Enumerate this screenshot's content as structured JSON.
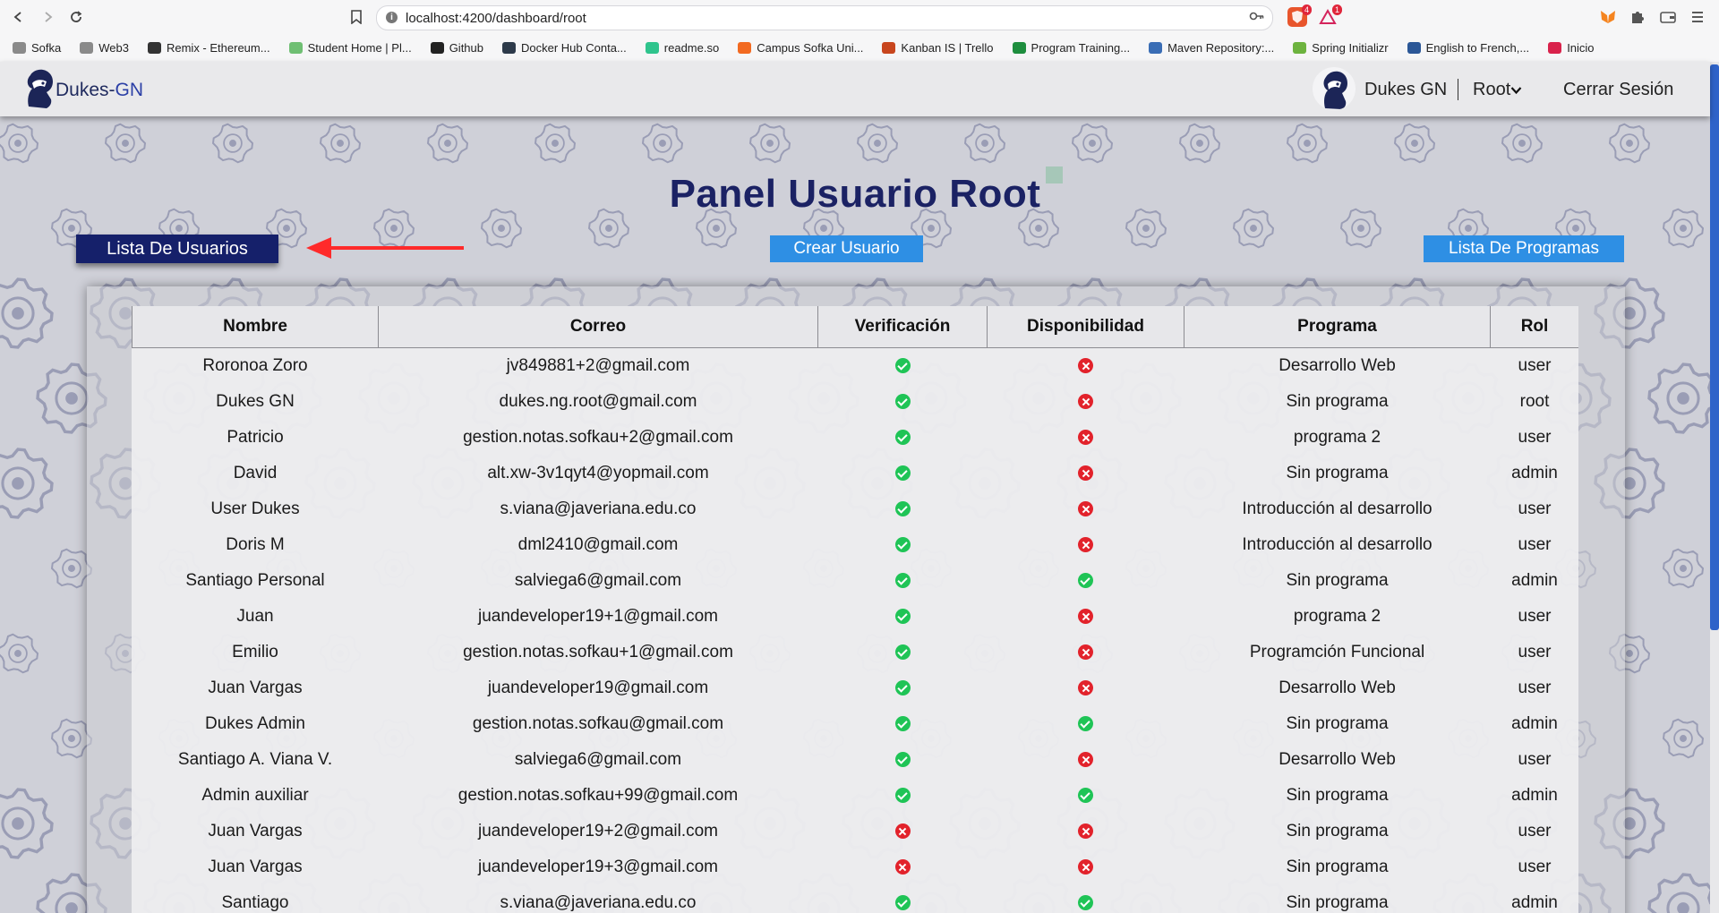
{
  "browser": {
    "url": "localhost:4200/dashboard/root",
    "extension_badges": [
      "4",
      "1"
    ],
    "bookmarks": [
      {
        "label": "Sofka",
        "color": "#8a8a8a"
      },
      {
        "label": "Web3",
        "color": "#8a8a8a"
      },
      {
        "label": "Remix - Ethereum...",
        "color": "#333333"
      },
      {
        "label": "Student Home | Pl...",
        "color": "#6fbf73"
      },
      {
        "label": "Github",
        "color": "#222222"
      },
      {
        "label": "Docker Hub Conta...",
        "color": "#2d3a4a"
      },
      {
        "label": "readme.so",
        "color": "#2fc48d"
      },
      {
        "label": "Campus Sofka Uni...",
        "color": "#f26a21"
      },
      {
        "label": "Kanban IS | Trello",
        "color": "#c8461e"
      },
      {
        "label": "Program Training...",
        "color": "#1e8e3e"
      },
      {
        "label": "Maven Repository:...",
        "color": "#3a6db5"
      },
      {
        "label": "Spring Initializr",
        "color": "#6db33f"
      },
      {
        "label": "English to French,...",
        "color": "#2b5797"
      },
      {
        "label": "Inicio",
        "color": "#d9224b"
      }
    ]
  },
  "header": {
    "brand_part1": "Dukes-",
    "brand_part2": "GN",
    "user_name": "Dukes GN",
    "role_menu": "Root",
    "logout": "Cerrar Sesión"
  },
  "page": {
    "title": "Panel Usuario Root",
    "btn_lista_usuarios": "Lista De Usuarios",
    "btn_crear_usuario": "Crear Usuario",
    "btn_lista_programas": "Lista De Programas"
  },
  "table": {
    "columns": [
      "Nombre",
      "Correo",
      "Verificación",
      "Disponibilidad",
      "Programa",
      "Rol"
    ],
    "rows": [
      {
        "nombre": "Roronoa Zoro",
        "correo": "jv849881+2@gmail.com",
        "verificado": true,
        "disponible": false,
        "programa": "Desarrollo Web",
        "rol": "user"
      },
      {
        "nombre": "Dukes GN",
        "correo": "dukes.ng.root@gmail.com",
        "verificado": true,
        "disponible": false,
        "programa": "Sin programa",
        "rol": "root"
      },
      {
        "nombre": "Patricio",
        "correo": "gestion.notas.sofkau+2@gmail.com",
        "verificado": true,
        "disponible": false,
        "programa": "programa 2",
        "rol": "user"
      },
      {
        "nombre": "David",
        "correo": "alt.xw-3v1qyt4@yopmail.com",
        "verificado": true,
        "disponible": false,
        "programa": "Sin programa",
        "rol": "admin"
      },
      {
        "nombre": "User Dukes",
        "correo": "s.viana@javeriana.edu.co",
        "verificado": true,
        "disponible": false,
        "programa": "Introducción al desarrollo",
        "rol": "user"
      },
      {
        "nombre": "Doris M",
        "correo": "dml2410@gmail.com",
        "verificado": true,
        "disponible": false,
        "programa": "Introducción al desarrollo",
        "rol": "user"
      },
      {
        "nombre": "Santiago Personal",
        "correo": "salviega6@gmail.com",
        "verificado": true,
        "disponible": true,
        "programa": "Sin programa",
        "rol": "admin"
      },
      {
        "nombre": "Juan",
        "correo": "juandeveloper19+1@gmail.com",
        "verificado": true,
        "disponible": false,
        "programa": "programa 2",
        "rol": "user"
      },
      {
        "nombre": "Emilio",
        "correo": "gestion.notas.sofkau+1@gmail.com",
        "verificado": true,
        "disponible": false,
        "programa": "Programción Funcional",
        "rol": "user"
      },
      {
        "nombre": "Juan Vargas",
        "correo": "juandeveloper19@gmail.com",
        "verificado": true,
        "disponible": false,
        "programa": "Desarrollo Web",
        "rol": "user"
      },
      {
        "nombre": "Dukes Admin",
        "correo": "gestion.notas.sofkau@gmail.com",
        "verificado": true,
        "disponible": true,
        "programa": "Sin programa",
        "rol": "admin"
      },
      {
        "nombre": "Santiago A. Viana V.",
        "correo": "salviega6@gmail.com",
        "verificado": true,
        "disponible": false,
        "programa": "Desarrollo Web",
        "rol": "user"
      },
      {
        "nombre": "Admin auxiliar",
        "correo": "gestion.notas.sofkau+99@gmail.com",
        "verificado": true,
        "disponible": true,
        "programa": "Sin programa",
        "rol": "admin"
      },
      {
        "nombre": "Juan Vargas",
        "correo": "juandeveloper19+2@gmail.com",
        "verificado": false,
        "disponible": false,
        "programa": "Sin programa",
        "rol": "user"
      },
      {
        "nombre": "Juan Vargas",
        "correo": "juandeveloper19+3@gmail.com",
        "verificado": false,
        "disponible": false,
        "programa": "Sin programa",
        "rol": "user"
      },
      {
        "nombre": "Santiago",
        "correo": "s.viana@javeriana.edu.co",
        "verificado": true,
        "disponible": true,
        "programa": "Sin programa",
        "rol": "admin"
      }
    ]
  },
  "colors": {
    "navy": "#15206a",
    "title": "#1b2264",
    "accent_blue": "#2e8fe4",
    "ok_green": "#1fc456",
    "error_red": "#e2222b",
    "annotation_arrow": "#ff2a2a"
  }
}
